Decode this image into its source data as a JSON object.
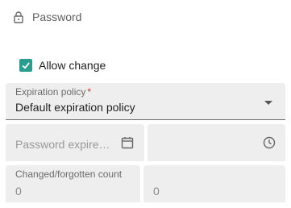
{
  "section": {
    "title": "Password",
    "icon": "lock-icon"
  },
  "allow_change": {
    "label": "Allow change",
    "checked": true
  },
  "expiration_policy": {
    "label": "Expiration policy",
    "required_mark": "*",
    "value": "Default expiration policy"
  },
  "password_expires": {
    "placeholder": "Password expires ...",
    "date_icon": "calendar-icon",
    "time_icon": "clock-icon"
  },
  "changed_count": {
    "label": "Changed/forgotten count",
    "changed_value": "0",
    "forgotten_value": "0"
  },
  "colors": {
    "accent": "#2a9d8f",
    "field_bg": "#eeeeee",
    "required": "#d32f2f"
  }
}
